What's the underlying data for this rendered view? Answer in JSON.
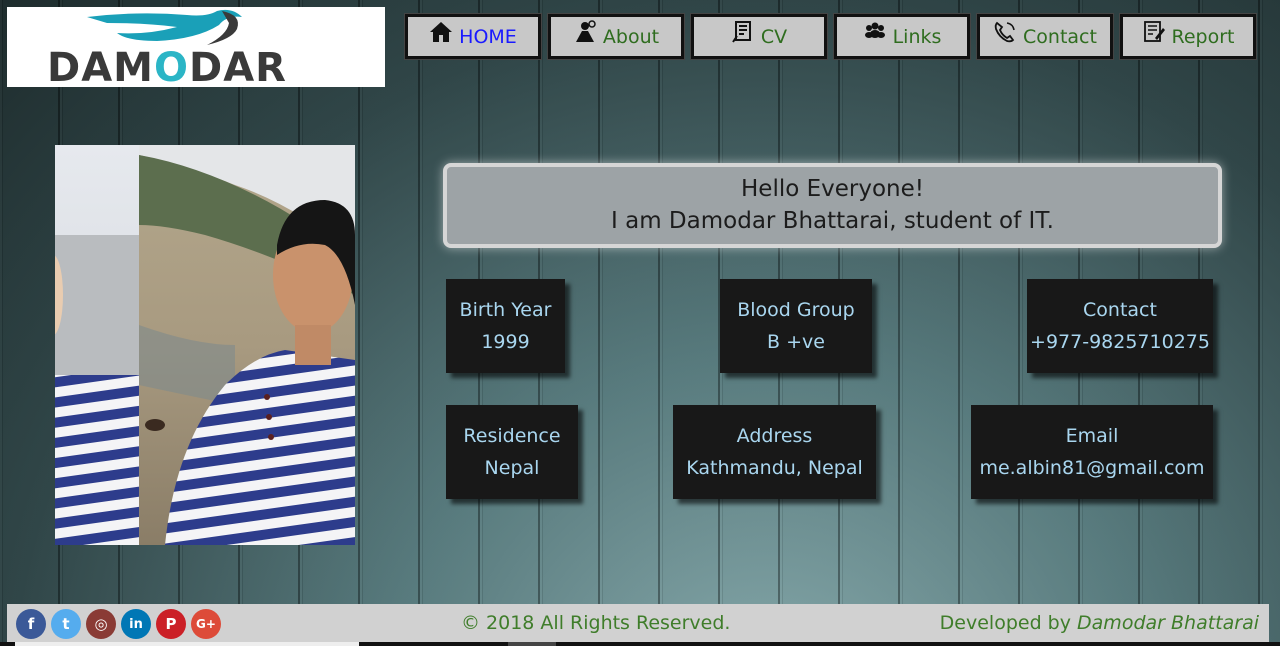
{
  "logo": {
    "text_left": "DAM",
    "text_o": "O",
    "text_right": "DAR"
  },
  "nav": [
    {
      "label": "HOME",
      "icon": "home-icon"
    },
    {
      "label": "About",
      "icon": "user-icon"
    },
    {
      "label": "CV",
      "icon": "cv-icon"
    },
    {
      "label": "Links",
      "icon": "users-group-icon"
    },
    {
      "label": "Contact",
      "icon": "phone-icon"
    },
    {
      "label": "Report",
      "icon": "report-icon"
    }
  ],
  "greeting": {
    "line1": "Hello Everyone!",
    "line2": "I am Damodar Bhattarai, student of IT."
  },
  "cards": [
    {
      "title": "Birth Year",
      "value": "1999"
    },
    {
      "title": "Blood Group",
      "value": "B +ve"
    },
    {
      "title": "Contact",
      "value": "+977-9825710275"
    },
    {
      "title": "Residence",
      "value": "Nepal"
    },
    {
      "title": "Address",
      "value": "Kathmandu, Nepal"
    },
    {
      "title": "Email",
      "value": "me.albin81@gmail.com"
    }
  ],
  "footer": {
    "socials": [
      {
        "letter": "f",
        "color": "#3b5998",
        "icon": "facebook-icon"
      },
      {
        "letter": "t",
        "color": "#55acee",
        "icon": "twitter-icon"
      },
      {
        "letter": "◎",
        "color": "#8a3b35",
        "icon": "instagram-icon"
      },
      {
        "letter": "in",
        "color": "#0077b5",
        "icon": "linkedin-icon"
      },
      {
        "letter": "P",
        "color": "#cb2027",
        "icon": "pinterest-icon"
      },
      {
        "letter": "G+",
        "color": "#dd4b39",
        "icon": "google-plus-icon"
      }
    ],
    "copyright": "© 2018 All Rights Reserved.",
    "developed_by_prefix": "Developed by",
    "developer_name": "Damodar Bhattarai"
  }
}
